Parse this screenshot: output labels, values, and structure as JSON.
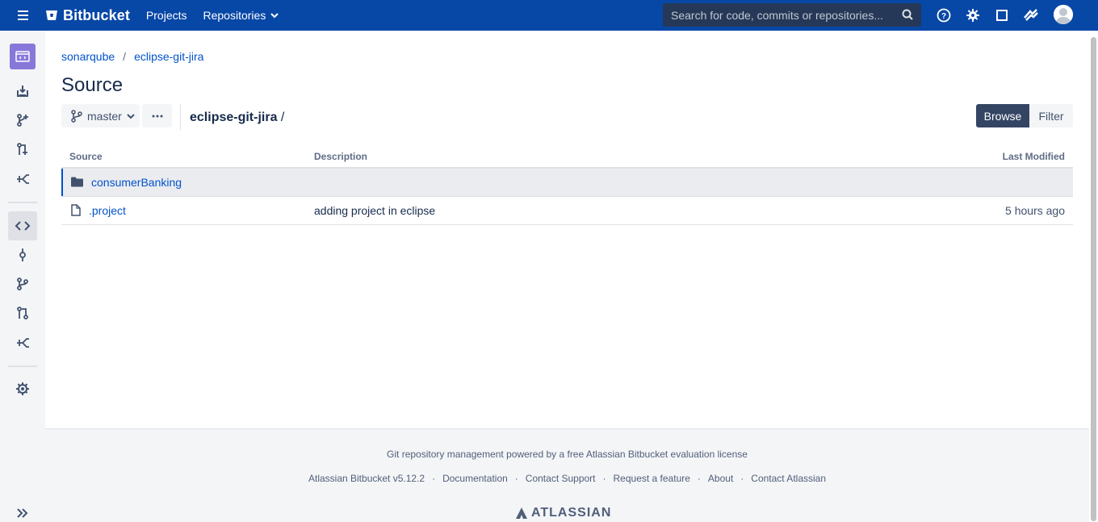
{
  "topbar": {
    "app_name": "Bitbucket",
    "nav": [
      "Projects",
      "Repositories"
    ],
    "search_placeholder": "Search for code, commits or repositories...",
    "icons": [
      "help-icon",
      "settings-icon",
      "tasks-icon",
      "notifications-icon",
      "avatar"
    ]
  },
  "sidebar": {
    "items": [
      "repository-avatar",
      "clone-icon",
      "create-branch-icon",
      "create-pull-request-icon",
      "fork-icon",
      "source-icon",
      "commits-icon",
      "branches-icon",
      "pull-requests-icon",
      "forks-icon",
      "settings-icon",
      "expand-icon"
    ]
  },
  "breadcrumb": {
    "project": "sonarqube",
    "separator": "/",
    "repo": "eclipse-git-jira"
  },
  "page_title": "Source",
  "branch": "master",
  "path": {
    "repo": "eclipse-git-jira",
    "suffix": " /"
  },
  "view_toggle": {
    "browse": "Browse",
    "filter": "Filter"
  },
  "table": {
    "headers": [
      "Source",
      "Description",
      "Last Modified"
    ],
    "rows": [
      {
        "name": "consumerBanking",
        "type": "folder",
        "description": "",
        "modified": ""
      },
      {
        "name": ".project",
        "type": "file",
        "description": "adding project in eclipse",
        "modified": "5 hours ago"
      }
    ]
  },
  "footer": {
    "license_text": "Git repository management powered by a free Atlassian Bitbucket evaluation license",
    "links": [
      "Atlassian Bitbucket v5.12.2",
      "Documentation",
      "Contact Support",
      "Request a feature",
      "About",
      "Contact Atlassian"
    ],
    "brand": "ATLASSIAN"
  },
  "colors": {
    "topbar": "#0747A6",
    "link": "#0052CC",
    "repo_avatar": "#8777D9",
    "browse_active": "#344563"
  }
}
